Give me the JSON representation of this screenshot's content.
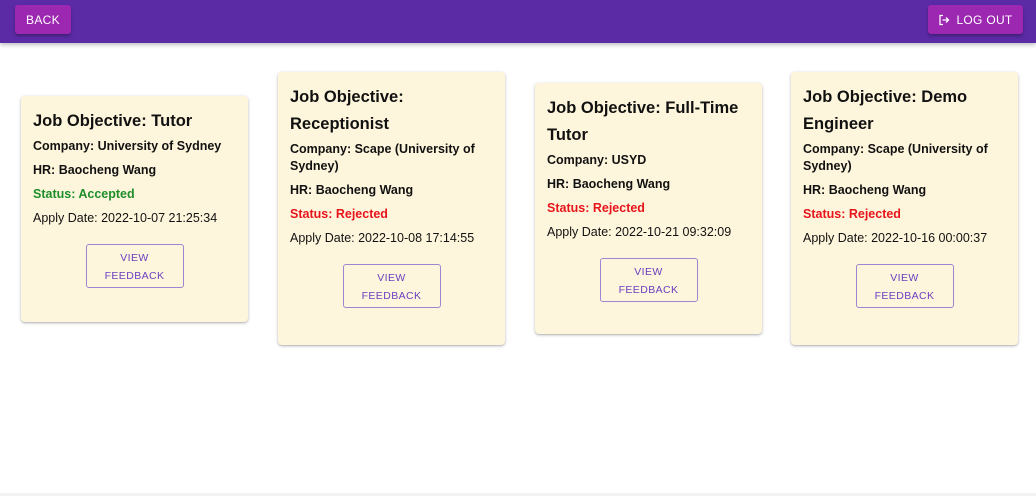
{
  "appbar": {
    "back_label": "BACK",
    "logout_label": "LOG OUT",
    "logout_icon": "logout-icon",
    "color": "#5b2ba6",
    "button_color": "#9c27b0"
  },
  "applications": [
    {
      "title": "Job Objective: Tutor",
      "company": "Company: University of Sydney",
      "hr": "HR: Baocheng Wang",
      "status": "Status: Accepted",
      "apply_date": "Apply Date: 2022-10-07 21:25:34",
      "feedback_line1": "VIEW",
      "feedback_line2": "FEEDBACK"
    },
    {
      "title": "Job Objective: Receptionist",
      "company": "Company: Scape (University of Sydney)",
      "hr": "HR: Baocheng Wang",
      "status": "Status: Rejected",
      "apply_date": "Apply Date: 2022-10-08 17:14:55",
      "feedback_line1": "VIEW",
      "feedback_line2": "FEEDBACK"
    },
    {
      "title": "Job Objective: Full-Time Tutor",
      "company": "Company: USYD",
      "hr": "HR: Baocheng Wang",
      "status": "Status: Rejected",
      "apply_date": "Apply Date: 2022-10-21 09:32:09",
      "feedback_line1": "VIEW",
      "feedback_line2": "FEEDBACK"
    },
    {
      "title": "Job Objective: Demo Engineer",
      "company": "Company: Scape (University of Sydney)",
      "hr": "HR: Baocheng Wang",
      "status": "Status: Rejected",
      "apply_date": "Apply Date: 2022-10-16 00:00:37",
      "feedback_line1": "VIEW",
      "feedback_line2": "FEEDBACK"
    }
  ],
  "colors": {
    "card_background": "#fef6dc",
    "status_accepted": "#1e8e2a",
    "status_rejected": "#e8141c",
    "feedback_button": "#6a3fc0"
  }
}
